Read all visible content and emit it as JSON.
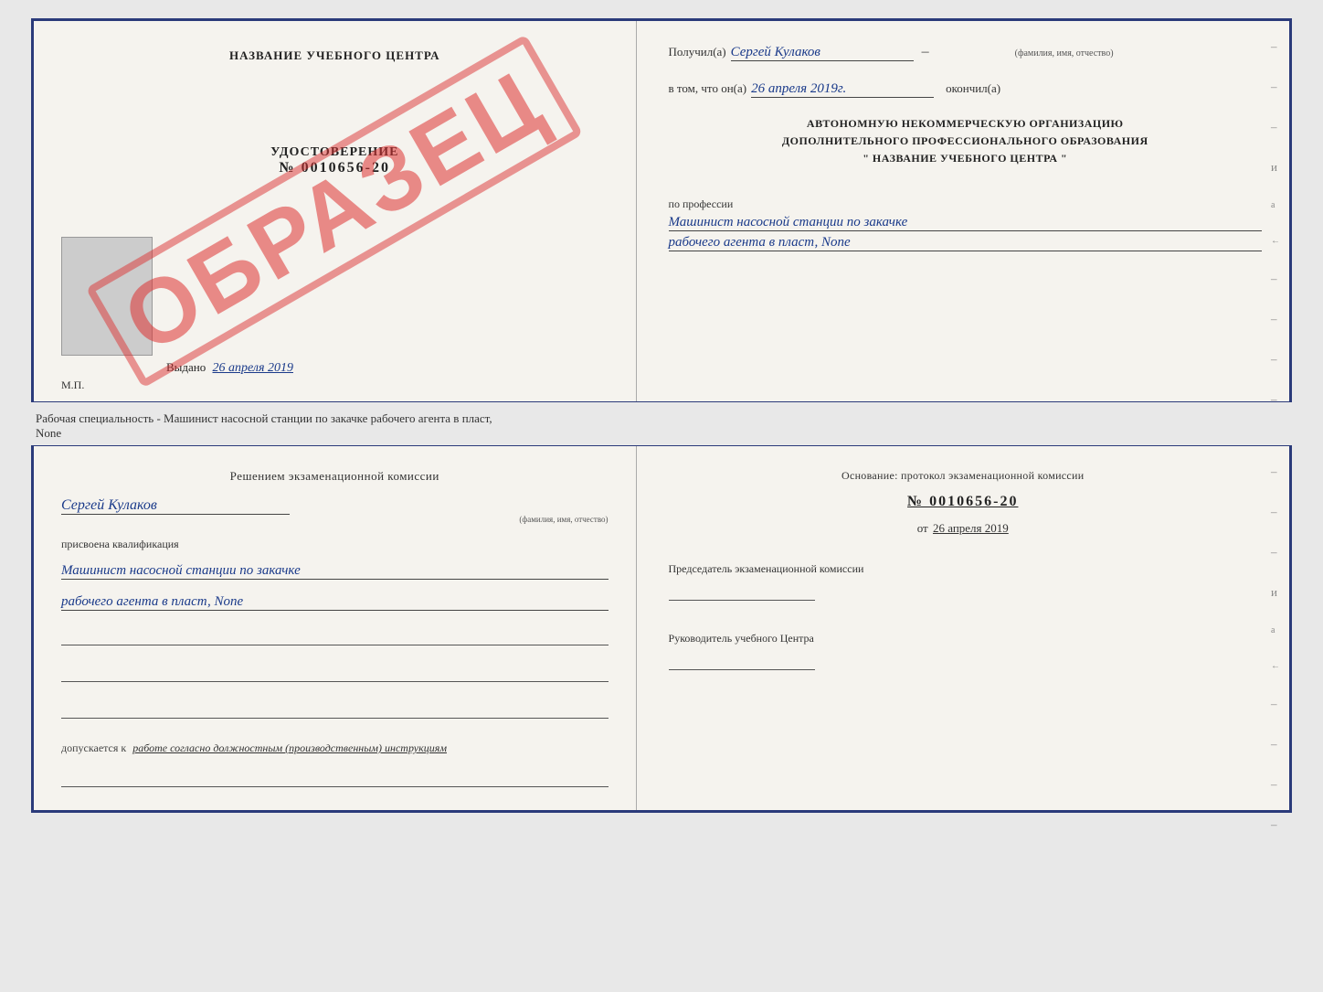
{
  "top_cert": {
    "left": {
      "center_title": "НАЗВАНИЕ УЧЕБНОГО ЦЕНТРА",
      "watermark": "ОБРАЗЕЦ",
      "cert_label": "УДОСТОВЕРЕНИЕ",
      "cert_number": "№ 0010656-20",
      "issued_label": "Выдано",
      "issued_date": "26 апреля 2019",
      "mp_label": "М.П."
    },
    "right": {
      "received_label": "Получил(а)",
      "received_name": "Сергей Кулаков",
      "name_hint": "(фамилия, имя, отчество)",
      "date_label": "в том, что он(а)",
      "date_value": "26 апреля 2019г.",
      "finished_label": "окончил(а)",
      "org_line1": "АВТОНОМНУЮ НЕКОММЕРЧЕСКУЮ ОРГАНИЗАЦИЮ",
      "org_line2": "ДОПОЛНИТЕЛЬНОГО ПРОФЕССИОНАЛЬНОГО ОБРАЗОВАНИЯ",
      "org_line3": "\"  НАЗВАНИЕ УЧЕБНОГО ЦЕНТРА  \"",
      "profession_label": "по профессии",
      "profession_line1": "Машинист насосной станции по закачке",
      "profession_line2": "рабочего агента в пласт, None"
    }
  },
  "separator": {
    "text": "Рабочая специальность - Машинист насосной станции по закачке рабочего агента в пласт,\nNone"
  },
  "bottom_cert": {
    "left": {
      "decision_text": "Решением экзаменационной комиссии",
      "name_value": "Сергей Кулаков",
      "name_hint": "(фамилия, имя, отчество)",
      "assigned_label": "присвоена квалификация",
      "qualification_line1": "Машинист насосной станции по закачке",
      "qualification_line2": "рабочего агента в пласт, None",
      "допускается_label": "допускается к",
      "допускается_value": "работе согласно должностным (производственным) инструкциям"
    },
    "right": {
      "basis_label": "Основание: протокол экзаменационной комиссии",
      "protocol_number": "№ 0010656-20",
      "protocol_date_label": "от",
      "protocol_date": "26 апреля 2019",
      "chairman_label": "Председатель экзаменационной комиссии",
      "head_label": "Руководитель учебного Центра"
    }
  }
}
